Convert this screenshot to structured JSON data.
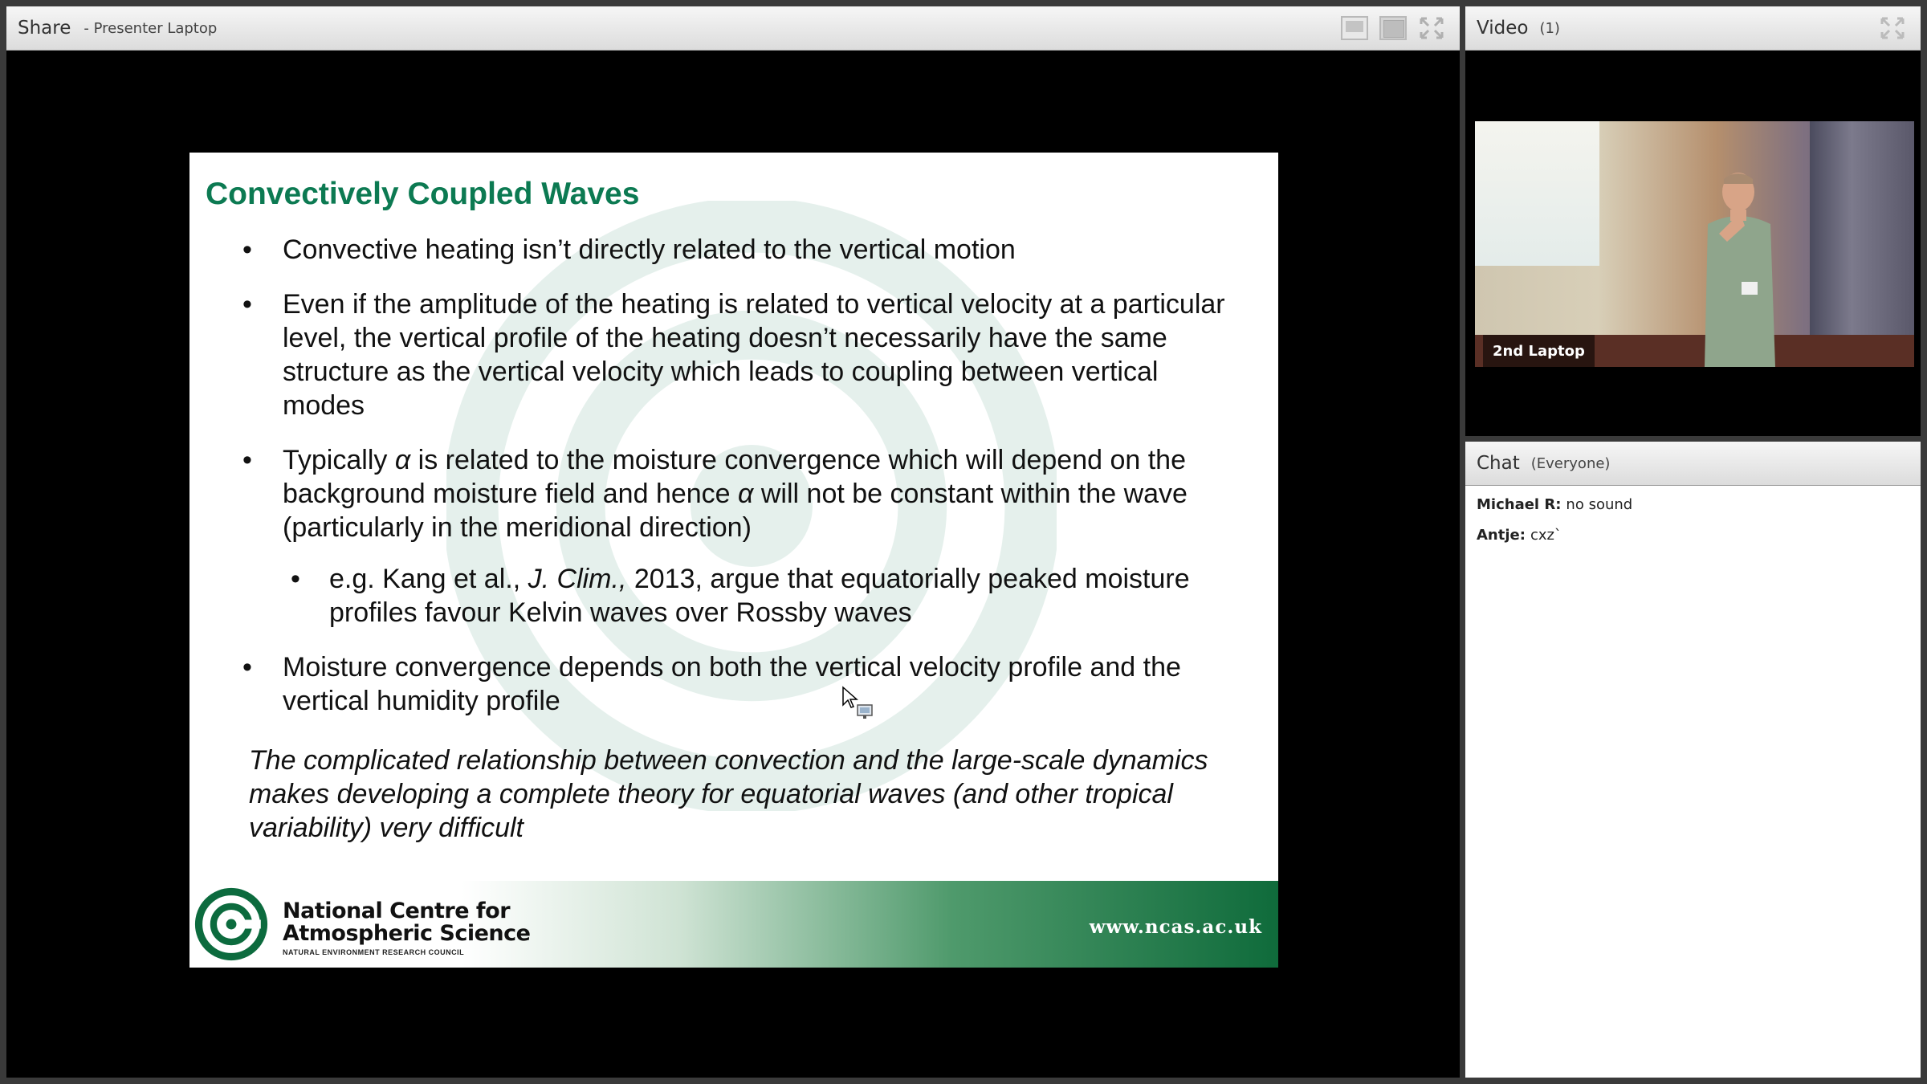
{
  "share_pod": {
    "title": "Share",
    "subtitle": "- Presenter Laptop"
  },
  "slide": {
    "title": "Convectively Coupled Waves",
    "bullets": [
      "Convective heating isn’t directly related to the vertical motion",
      "Even if the amplitude of the heating is related to vertical velocity at a particular level,  the vertical profile of the heating doesn’t necessarily have the same structure as the vertical velocity which leads to coupling between vertical modes",
      {
        "pre": "Typically ",
        "symbol1": "α",
        "mid": " is related to the moisture convergence which will depend on the background moisture field and hence ",
        "symbol2": "α",
        "post": " will not be constant within the wave (particularly in the meridional direction)"
      },
      {
        "pre": "e.g. Kang et al., ",
        "journal": "J. Clim.,",
        "post": " 2013, argue that equatorially peaked moisture profiles favour Kelvin waves over Rossby waves"
      },
      "Moisture convergence depends on both the vertical velocity profile and the vertical humidity profile"
    ],
    "bullet_symbol": "•",
    "note": "The complicated relationship between convection and the large-scale dynamics makes developing a complete theory for equatorial waves (and other tropical variability) very difficult",
    "footer": {
      "org_line1": "National Centre for",
      "org_line2": "Atmospheric Science",
      "council": "NATURAL ENVIRONMENT RESEARCH COUNCIL",
      "url": "www.ncas.ac.uk"
    },
    "colors": {
      "title": "#0c7a52",
      "footer_green": "#0f6b3b"
    }
  },
  "video_pod": {
    "title": "Video",
    "count": "(1)",
    "feed_label": "2nd Laptop"
  },
  "chat_pod": {
    "title": "Chat",
    "audience": "(Everyone)",
    "messages": [
      {
        "sender": "Michael R:",
        "text": "no sound"
      },
      {
        "sender": "Antje:",
        "text": "cxz`"
      }
    ]
  }
}
